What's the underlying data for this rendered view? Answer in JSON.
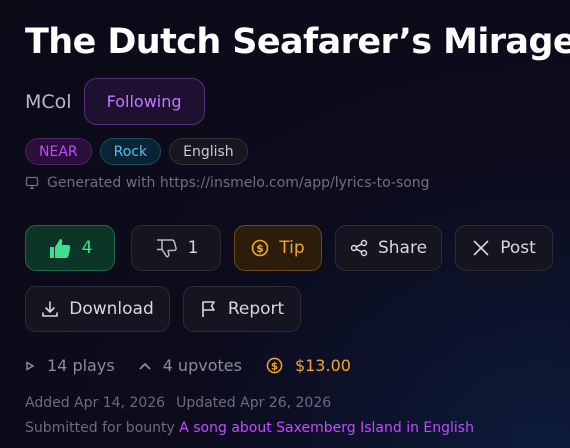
{
  "song": {
    "title": "The Dutch Seafarer’s Mirage",
    "author": "MCol"
  },
  "follow": {
    "label": "Following"
  },
  "tags": [
    "NEAR",
    "Rock",
    "English"
  ],
  "generated": {
    "text": "Generated with https://insmelo.com/app/lyrics-to-song",
    "icon": "monitor-icon"
  },
  "actions": {
    "like_count": "4",
    "dislike_count": "1",
    "tip_label": "Tip",
    "share_label": "Share",
    "post_label": "Post",
    "download_label": "Download",
    "report_label": "Report"
  },
  "stats": {
    "plays": "14 plays",
    "upvotes": "4 upvotes",
    "earnings": "$13.00"
  },
  "dates": {
    "added": "Added Apr 14, 2026",
    "updated": "Updated Apr 26, 2026"
  },
  "bounty": {
    "prefix": "Submitted for bounty",
    "link": "A song about Saxemberg Island in English"
  },
  "colors": {
    "accent_purple": "#c07aff",
    "like_green": "#3fe08d",
    "tip_orange": "#f5a623",
    "rock_blue": "#4cc3ef"
  }
}
